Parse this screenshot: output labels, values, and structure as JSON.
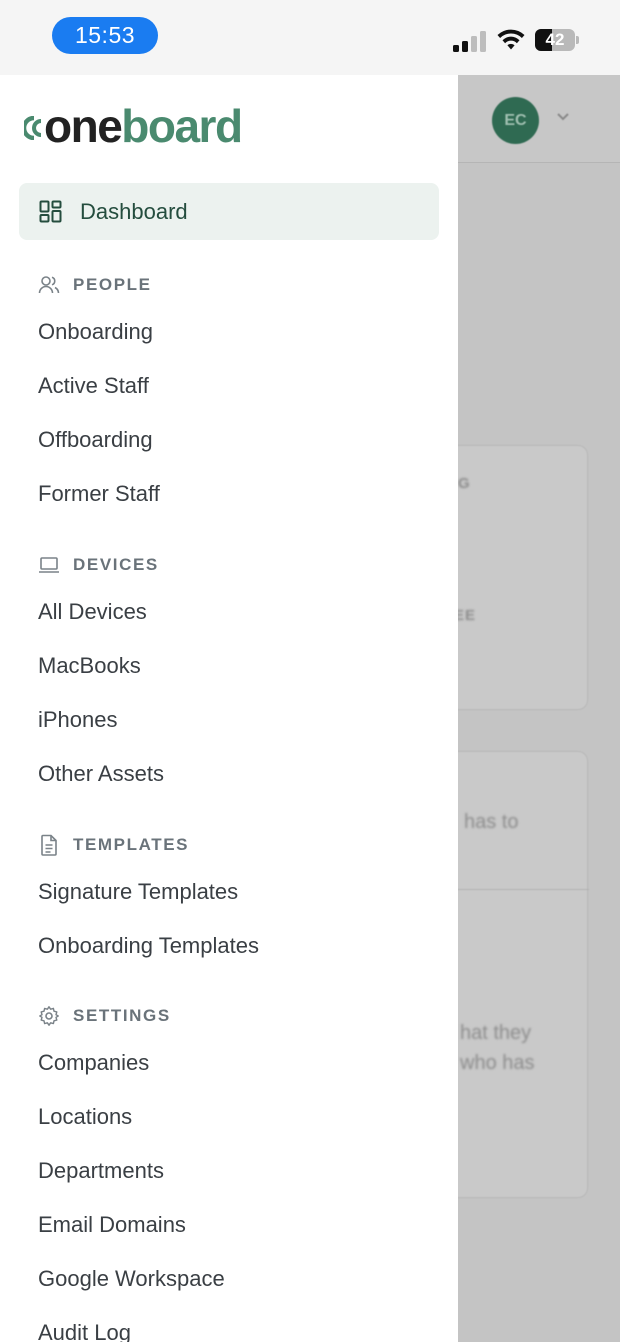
{
  "status_bar": {
    "time": "15:53",
    "battery_level": "42",
    "battery_fraction": 0.42,
    "signal_bars_active": 2,
    "icons": [
      "signal-icon",
      "wifi-icon",
      "battery-icon"
    ]
  },
  "backdrop": {
    "avatar_initials": "EC",
    "fragment_1": "G",
    "fragment_2": "EE",
    "fragment_3": "has to",
    "fragment_4": "hat they",
    "fragment_5": "who has"
  },
  "logo": {
    "prefix": "one",
    "suffix": "board",
    "alt": "oneboard"
  },
  "nav": {
    "dashboard": {
      "label": "Dashboard",
      "icon": "dashboard-grid-icon"
    },
    "people": {
      "heading": "PEOPLE",
      "icon": "people-icon",
      "items": [
        "Onboarding",
        "Active Staff",
        "Offboarding",
        "Former Staff"
      ]
    },
    "devices": {
      "heading": "DEVICES",
      "icon": "laptop-icon",
      "items": [
        "All Devices",
        "MacBooks",
        "iPhones",
        "Other Assets"
      ]
    },
    "templates": {
      "heading": "TEMPLATES",
      "icon": "document-icon",
      "items": [
        "Signature Templates",
        "Onboarding Templates"
      ]
    },
    "settings": {
      "heading": "SETTINGS",
      "icon": "gear-icon",
      "items": [
        "Companies",
        "Locations",
        "Departments",
        "Email Domains",
        "Google Workspace",
        "Audit Log"
      ]
    }
  },
  "colors": {
    "brand_green": "#4a8a6f",
    "active_bg": "#ecf2ef",
    "active_text": "#244d3e",
    "time_pill": "#1a7cf1"
  }
}
